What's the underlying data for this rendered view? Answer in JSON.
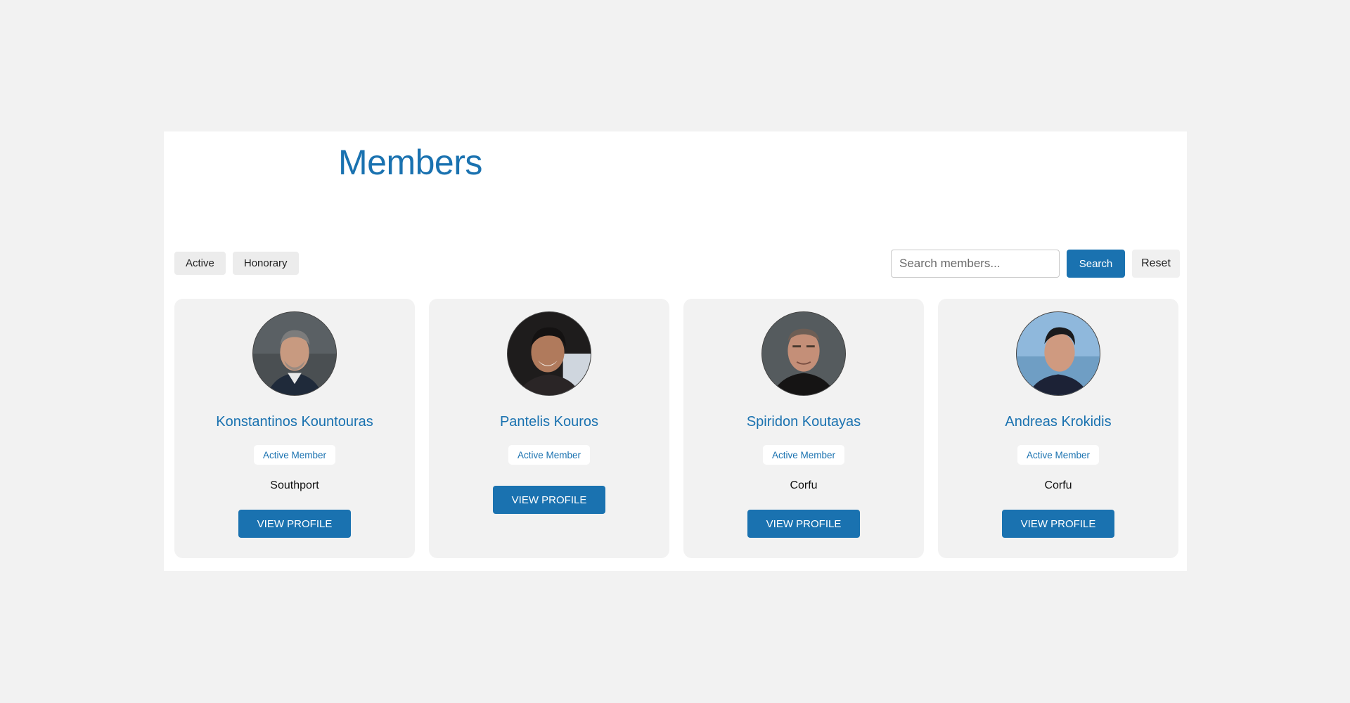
{
  "page": {
    "title": "Members"
  },
  "filters": [
    "Active",
    "Honorary"
  ],
  "search": {
    "placeholder": "Search members...",
    "value": "",
    "search_label": "Search",
    "reset_label": "Reset"
  },
  "members": [
    {
      "name": "Konstantinos Kountouras",
      "badge": "Active Member",
      "location": "Southport",
      "button_label": "VIEW PROFILE"
    },
    {
      "name": "Pantelis Kouros",
      "badge": "Active Member",
      "location": "",
      "button_label": "VIEW PROFILE"
    },
    {
      "name": "Spiridon Koutayas",
      "badge": "Active Member",
      "location": "Corfu",
      "button_label": "VIEW PROFILE"
    },
    {
      "name": "Andreas Krokidis",
      "badge": "Active Member",
      "location": "Corfu",
      "button_label": "VIEW PROFILE"
    }
  ],
  "colors": {
    "accent": "#1a72b0",
    "page_background": "#f2f2f2",
    "card_background": "#f2f2f2",
    "panel_background": "#ffffff"
  }
}
